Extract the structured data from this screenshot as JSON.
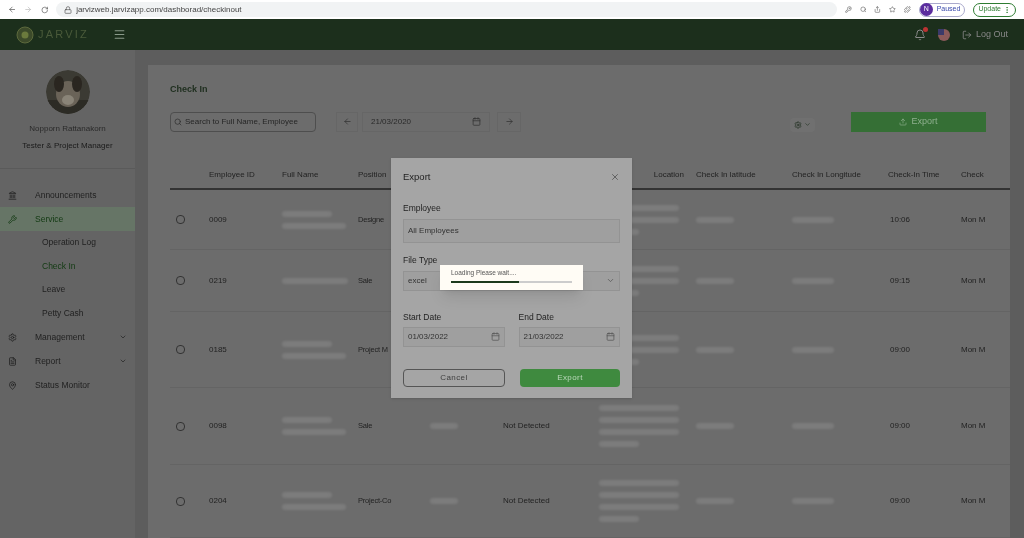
{
  "browser": {
    "url": "jarvizweb.jarvizapp.com/dashborad/checkinout",
    "profile": {
      "initial": "N",
      "label": "Paused"
    },
    "update_button": "Update"
  },
  "header": {
    "logo": "JARVIZ",
    "logout": "Log Out"
  },
  "sidebar": {
    "user": {
      "name": "Nopporn Rattanakorn",
      "role": "Tester & Project Manager"
    },
    "items": [
      {
        "label": "Announcements",
        "selected": false
      },
      {
        "label": "Service",
        "selected": true,
        "expanded": true,
        "children": [
          {
            "label": "Operation Log",
            "selected": false
          },
          {
            "label": "Check In",
            "selected": true
          },
          {
            "label": "Leave",
            "selected": false
          },
          {
            "label": "Petty Cash",
            "selected": false
          }
        ]
      },
      {
        "label": "Management",
        "selected": false,
        "expanded": false
      },
      {
        "label": "Report",
        "selected": false,
        "expanded": false
      },
      {
        "label": "Status Monitor",
        "selected": false
      }
    ]
  },
  "content": {
    "title": "Check In",
    "search": {
      "placeholder": "Search to Full Name, Employee"
    },
    "date": "21/03/2020",
    "export_button": "Export",
    "columns": [
      "Employee ID",
      "Full Name",
      "Position",
      "Location",
      "Check In latitude",
      "Check In Longitude",
      "Check-In Time",
      "Check"
    ],
    "rows": [
      {
        "checked": false,
        "employee_id": "0009",
        "position": "Designe",
        "check_in_time": "10:06",
        "column_11": "Mon M"
      },
      {
        "checked": false,
        "employee_id": "0219",
        "position": "Sale",
        "check_in_time": "09:15",
        "column_11": "Mon M"
      },
      {
        "checked": false,
        "employee_id": "0185",
        "position": "Project M",
        "check_in_time": "09:00",
        "column_11": "Mon M"
      },
      {
        "checked": false,
        "employee_id": "0098",
        "position": "Sale",
        "column_5": "Not Detected",
        "check_in_time": "09:00",
        "column_11": "Mon M"
      },
      {
        "checked": false,
        "employee_id": "0204",
        "position": "Project-Co",
        "column_5": "Not Detected",
        "check_in_time": "09:00",
        "column_11": "Mon M"
      }
    ]
  },
  "export_dialog": {
    "title": "Export",
    "employee": {
      "label": "Employee",
      "value": "All Employees"
    },
    "file_type": {
      "label": "File Type",
      "value": "excel"
    },
    "start_date": {
      "label": "Start Date",
      "value": "01/03/2022"
    },
    "end_date": {
      "label": "End Date",
      "value": "21/03/2022"
    },
    "cancel_button": "Cancel",
    "export_button": "Export"
  },
  "loading": {
    "text": "Loading Please wait....",
    "level": 0.56
  }
}
